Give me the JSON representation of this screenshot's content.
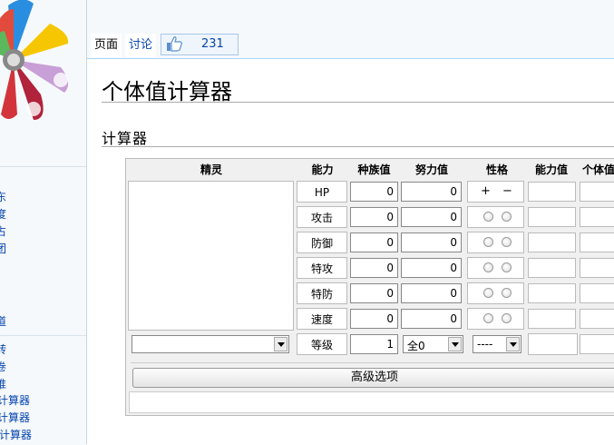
{
  "sidebar": {
    "links": [
      "东",
      "度",
      "占",
      "团",
      "道",
      "转",
      "卷",
      "推",
      "计算器",
      "计算器",
      "计算器"
    ]
  },
  "tabs": {
    "page": "页面",
    "talk": "讨论",
    "like_count": "231"
  },
  "page": {
    "title": "个体值计算器",
    "section": "计算器"
  },
  "calculator": {
    "headers": {
      "pokemon": "精灵",
      "stat": "能力",
      "base": "种族值",
      "ev": "努力值",
      "nature": "性格",
      "value": "能力值",
      "iv": "个体值"
    },
    "rows": [
      {
        "stat": "HP",
        "base": "0",
        "ev": "0"
      },
      {
        "stat": "攻击",
        "base": "0",
        "ev": "0"
      },
      {
        "stat": "防御",
        "base": "0",
        "ev": "0"
      },
      {
        "stat": "特攻",
        "base": "0",
        "ev": "0"
      },
      {
        "stat": "特防",
        "base": "0",
        "ev": "0"
      },
      {
        "stat": "速度",
        "base": "0",
        "ev": "0"
      }
    ],
    "nature_plus": "+",
    "nature_minus": "−",
    "level_label": "等级",
    "level_value": "1",
    "ev_select": "全0",
    "nature_select": "----",
    "advanced_button": "高级选项"
  }
}
